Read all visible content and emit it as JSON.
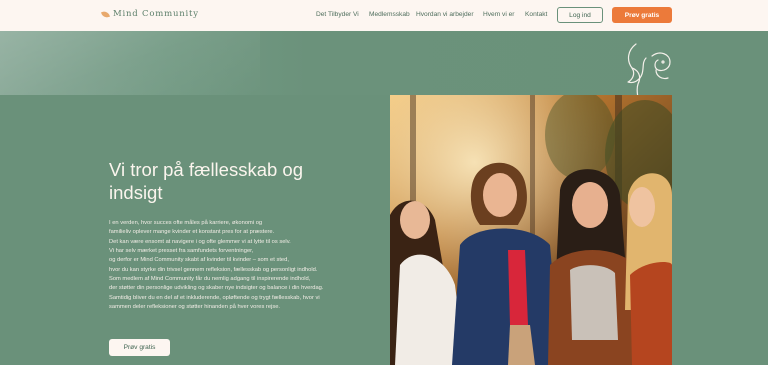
{
  "brand": {
    "name": "Mind Community"
  },
  "nav": {
    "items": [
      {
        "label": "Det Tilbyder Vi"
      },
      {
        "label": "Medlemsskab"
      },
      {
        "label": "Hvordan vi arbejder"
      },
      {
        "label": "Hvem vi er"
      },
      {
        "label": "Kontakt"
      }
    ],
    "login_label": "Log ind",
    "cta_label": "Prøv gratis"
  },
  "hero": {
    "title_lines": [
      "Vi tror på fællesskab og",
      "indsigt"
    ],
    "body_lines": [
      "I en verden, hvor succes ofte måles på karriere, økonomi og",
      "familieliv oplever mange kvinder et konstant pres for at præstere.",
      "Det kan være ensomt at navigere i og ofte glemmer vi at lytte til os selv.",
      "Vi har selv mærket presset fra samfundets forventninger,",
      "og derfor er Mind Community skabt af kvinder til kvinder – som et sted,",
      "hvor du kan styrke din trivsel gennem refleksion, fællesskab og personligt indhold.",
      "Som medlem af Mind Community får du nemlig adgang til inspirerende indhold,",
      "der støtter din personlige udvikling og skaber nye indsigter og balance i din hverdag.",
      "Samtidig bliver du en del af et inkluderende, opløftende og trygt fællesskab, hvor vi",
      "sammen deler refleksioner og støtter hinanden på hver vores rejse."
    ],
    "cta_label": "Prøv gratis"
  },
  "colors": {
    "background": "#6a917a",
    "header_bg": "#fdf6f1",
    "accent": "#ec7a3a",
    "text_light": "#fbf5ee"
  }
}
